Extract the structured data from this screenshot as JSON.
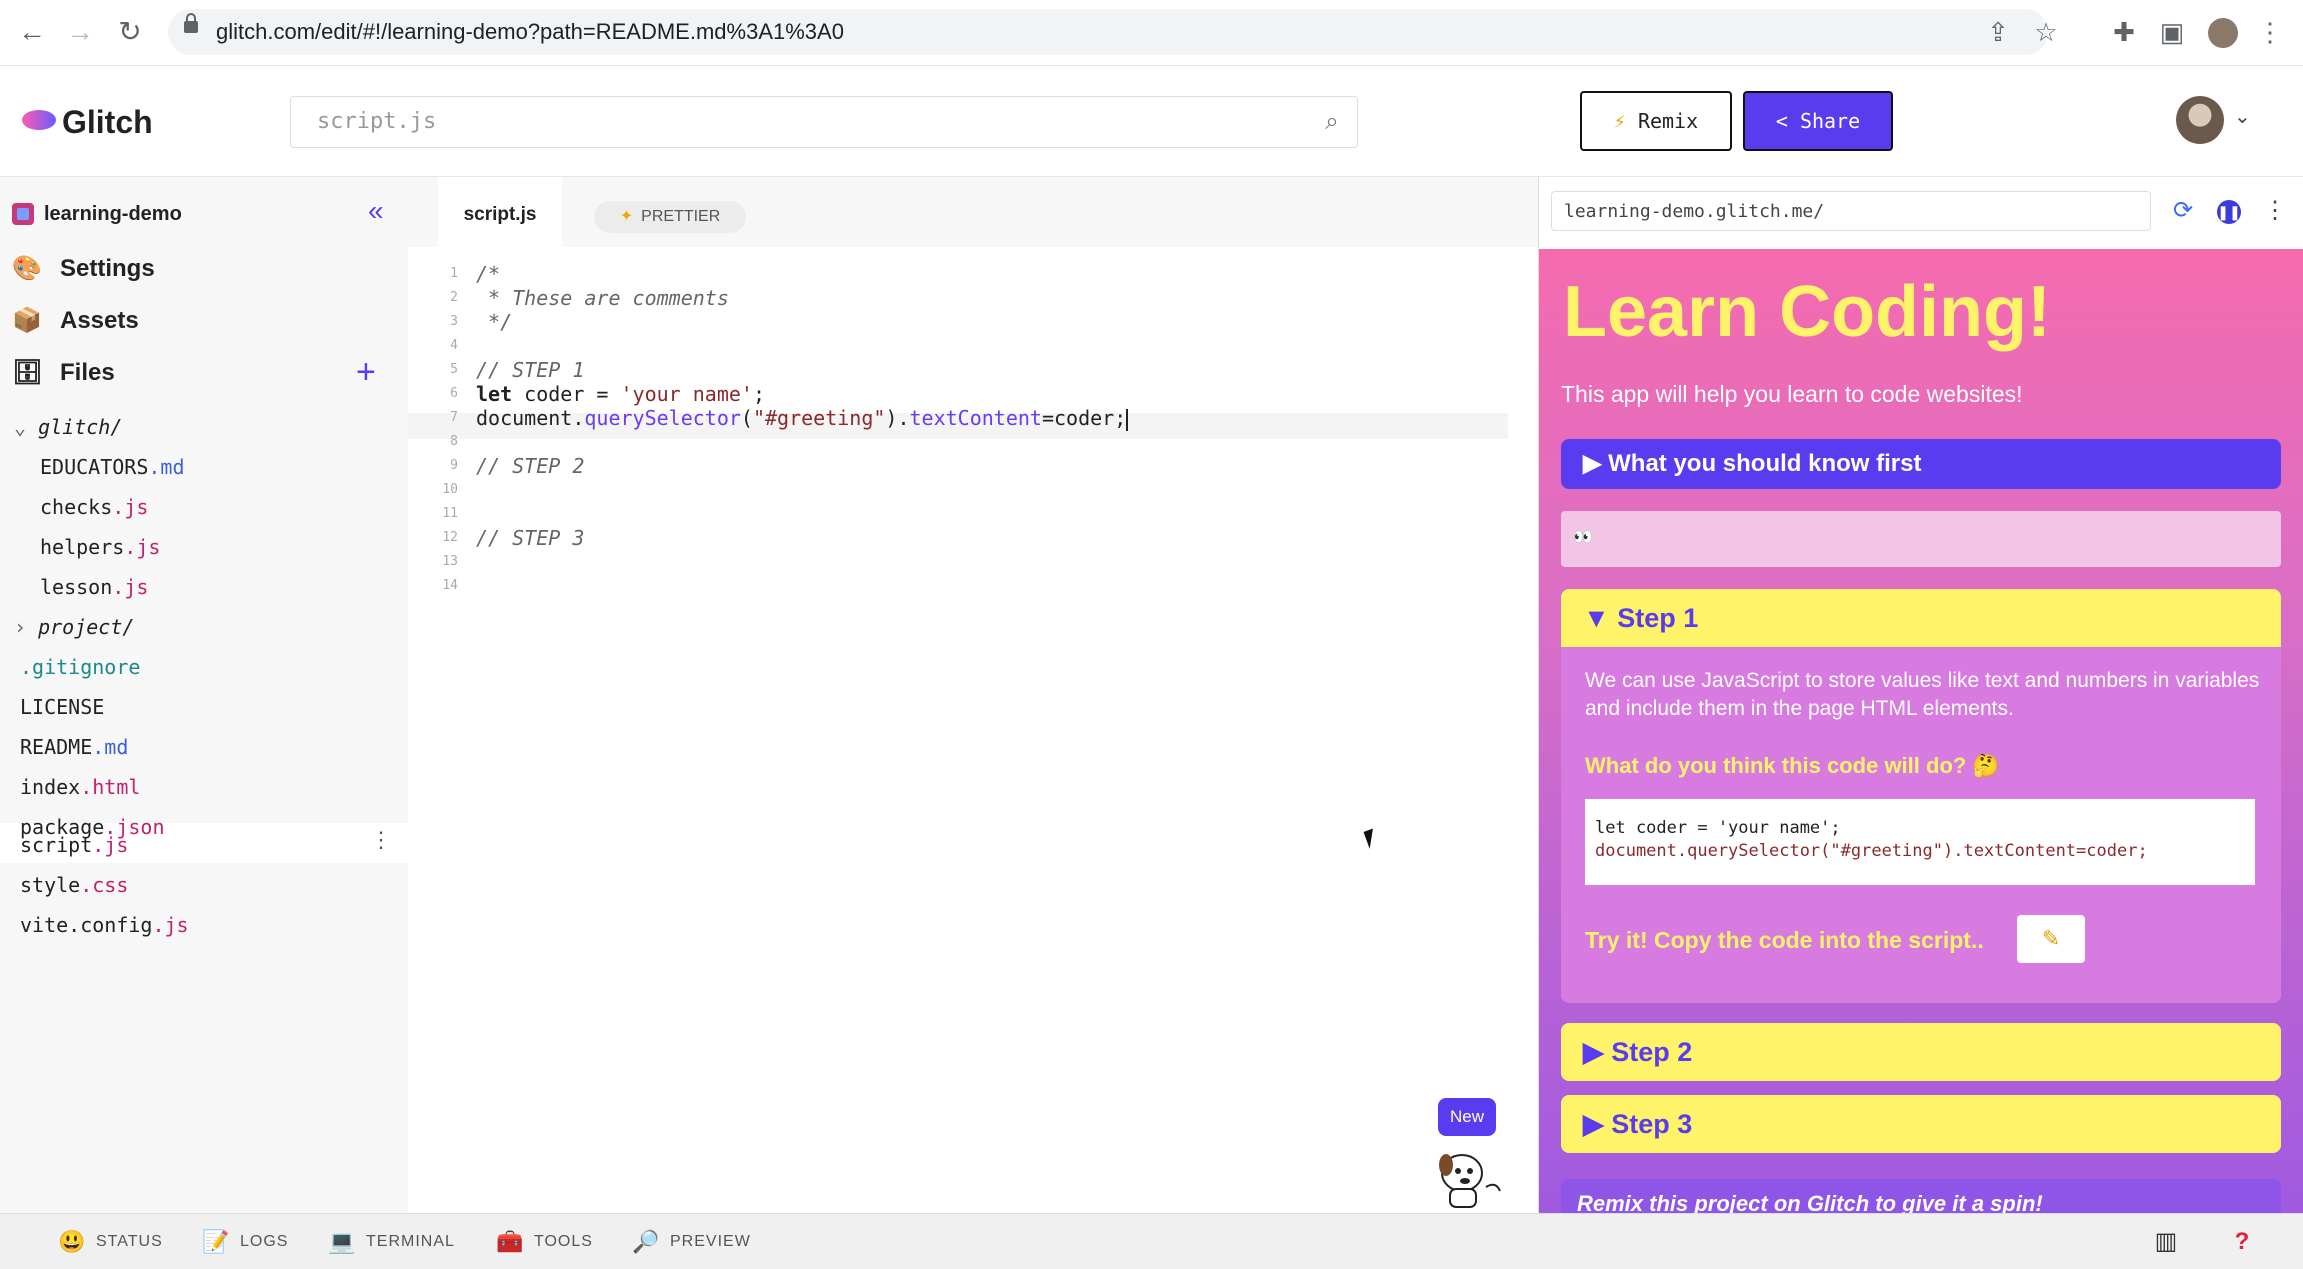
{
  "browser": {
    "url": "glitch.com/edit/#!/learning-demo?path=README.md%3A1%3A0"
  },
  "header": {
    "logo_text": "Glitch",
    "search_placeholder": "script.js",
    "remix_label": "Remix",
    "share_label": "Share"
  },
  "sidebar": {
    "project_name": "learning-demo",
    "nav": [
      {
        "label": "Settings"
      },
      {
        "label": "Assets"
      },
      {
        "label": "Files"
      }
    ],
    "files": [
      {
        "base": "glitch/",
        "ext": ""
      },
      {
        "base": "EDUCATORS",
        "ext": ".md"
      },
      {
        "base": "checks",
        "ext": ".js"
      },
      {
        "base": "helpers",
        "ext": ".js"
      },
      {
        "base": "lesson",
        "ext": ".js"
      },
      {
        "base": "project/",
        "ext": ""
      },
      {
        "base": ".gitignore",
        "ext": ""
      },
      {
        "base": "LICENSE",
        "ext": ""
      },
      {
        "base": "README",
        "ext": ".md"
      },
      {
        "base": "index",
        "ext": ".html"
      },
      {
        "base": "package",
        "ext": ".json"
      },
      {
        "base": "script",
        "ext": ".js"
      },
      {
        "base": "style",
        "ext": ".css"
      },
      {
        "base": "vite.config",
        "ext": ".js"
      }
    ]
  },
  "editor": {
    "tab_label": "script.js",
    "prettier_label": "PRETTIER",
    "line_numbers": [
      "1",
      "2",
      "3",
      "4",
      "5",
      "6",
      "7",
      "8",
      "9",
      "10",
      "11",
      "12",
      "13",
      "14"
    ],
    "lines": {
      "l1": "/*",
      "l2": " * These are comments",
      "l3": " */",
      "l5": "// STEP 1",
      "l6_kw": "let",
      "l6_rest": " coder = ",
      "l6_str": "'your name'",
      "l6_end": ";",
      "l7_a": "document.",
      "l7_b": "querySelector",
      "l7_c": "(",
      "l7_d": "\"#greeting\"",
      "l7_e": ").",
      "l7_f": "textContent",
      "l7_g": "=coder;",
      "l9": "// STEP 2",
      "l12": "// STEP 3"
    },
    "new_badge": "New"
  },
  "preview": {
    "url": "learning-demo.glitch.me/",
    "title": "Learn Coding!",
    "subtitle": "This app will help you learn to code websites!",
    "know_first": "▶ What you should know first",
    "eyes": "👀",
    "step1_head": "▼ Step 1",
    "step1_para": "We can use JavaScript to store values like text and numbers in variables and include them in the page HTML elements.",
    "step1_question": "What do you think this code will do? 🤔",
    "step1_code_line1": "let coder = 'your name';",
    "step1_code_line2": "document.querySelector(\"#greeting\").textContent=coder;",
    "step1_try": "Try it! Copy the code into the script..",
    "pencil": "✎",
    "step2_head": "▶ Step 2",
    "step3_head": "▶ Step 3",
    "remix_line": "Remix this project on Glitch to give it a spin!"
  },
  "statusbar": {
    "status": "STATUS",
    "logs": "LOGS",
    "terminal": "TERMINAL",
    "tools": "TOOLS",
    "preview": "PREVIEW"
  }
}
